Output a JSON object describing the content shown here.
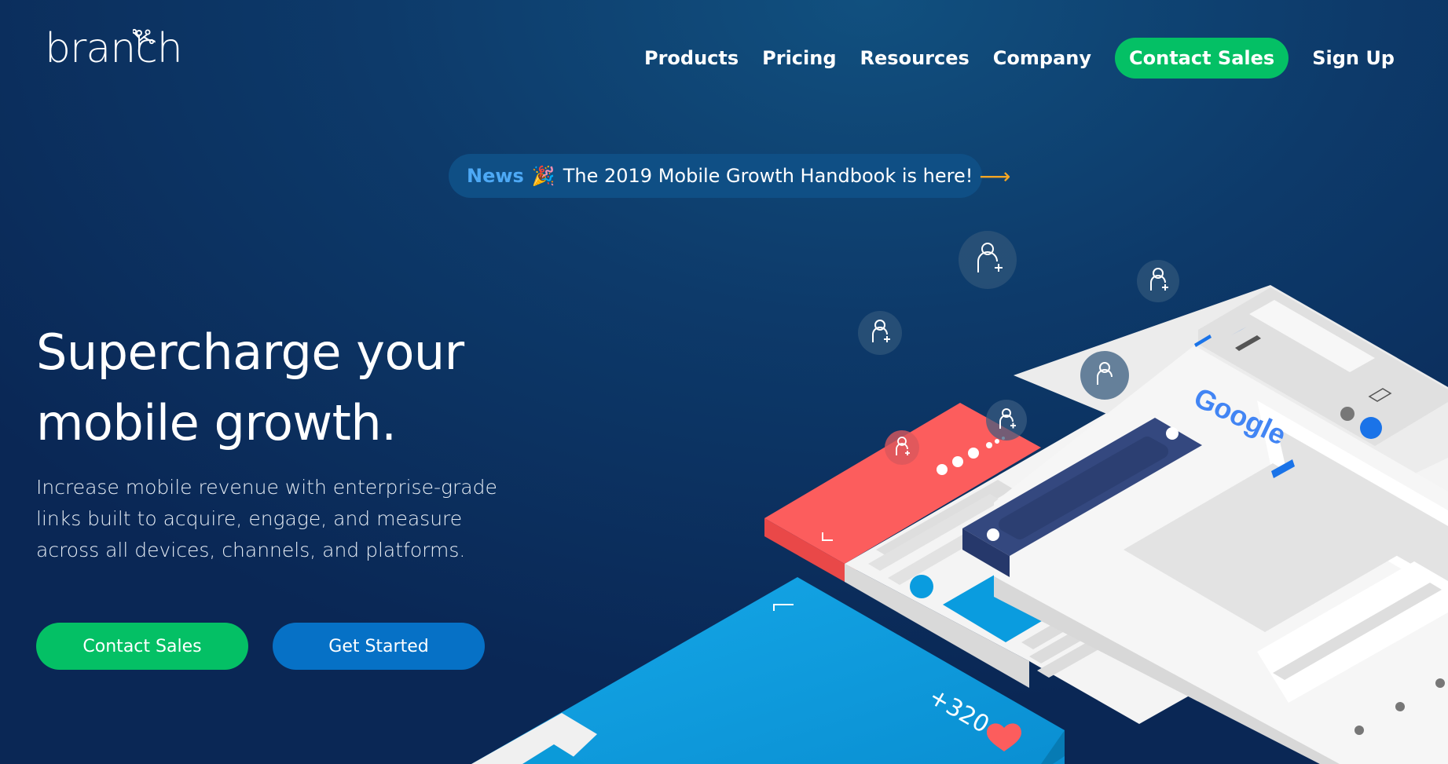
{
  "brand": {
    "logo_text": "branch"
  },
  "nav": {
    "items": [
      "Products",
      "Pricing",
      "Resources",
      "Company"
    ],
    "contact_sales": "Contact Sales",
    "sign_up": "Sign Up"
  },
  "news": {
    "label": "News",
    "icon": "party-popper-icon",
    "emoji": "🎉",
    "text": "The 2019 Mobile Growth Handbook is here!",
    "arrow": "⟶"
  },
  "hero": {
    "title": "Supercharge your\nmobile growth.",
    "subtitle": "Increase mobile revenue with enterprise-grade links built to acquire, engage, and measure across all devices, channels, and platforms.",
    "buttons": {
      "contact_sales": "Contact Sales",
      "get_started": "Get Started"
    }
  },
  "illustration": {
    "search_logo": "Google",
    "social_count": "+320"
  },
  "colors": {
    "background": "#0d3a6a",
    "cta_green": "#04c065",
    "cta_blue": "#0671c6",
    "news_accent": "#4da9f5",
    "arrow_orange": "#f5a623",
    "card_red": "#fc5d5d",
    "card_blue": "#0a9cdf",
    "card_navy": "#34487f"
  }
}
